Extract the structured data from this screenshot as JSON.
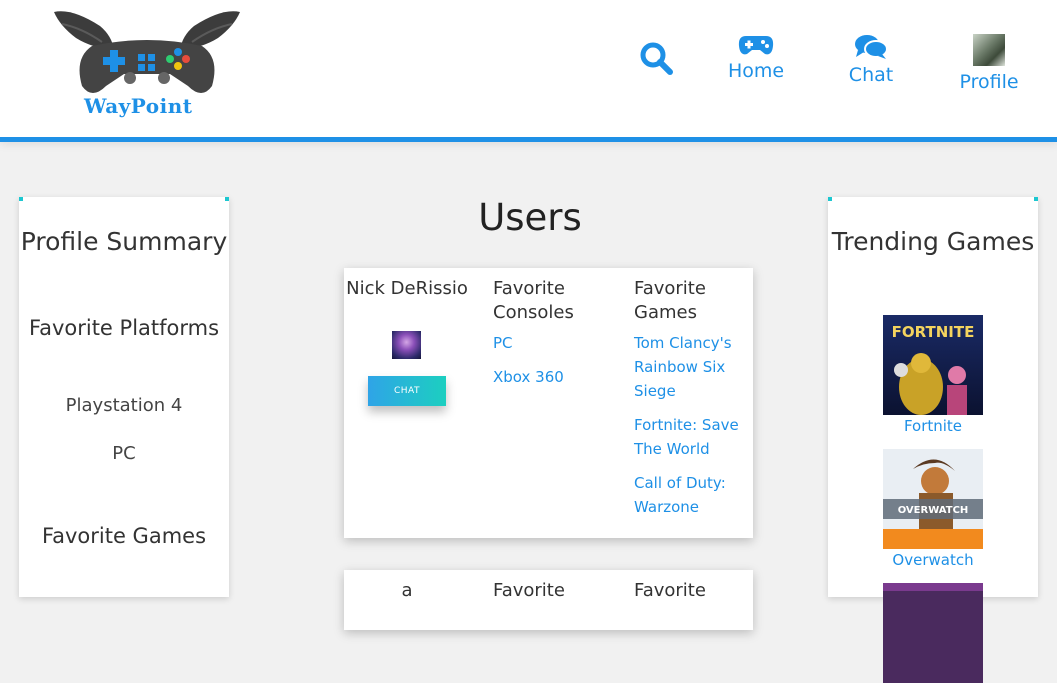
{
  "brand": {
    "name": "WayPoint"
  },
  "nav": {
    "home_label": "Home",
    "chat_label": "Chat",
    "profile_label": "Profile"
  },
  "colors": {
    "accent": "#1e90e6",
    "button_gradient_start": "#2fa4e7",
    "button_gradient_end": "#1ccfc0"
  },
  "profile_summary": {
    "title": "Profile Summary",
    "favorite_platforms_title": "Favorite Platforms",
    "platforms": [
      "Playstation 4",
      "PC"
    ],
    "favorite_games_title": "Favorite Games"
  },
  "users_title": "Users",
  "users": [
    {
      "name": "Nick DeRissio",
      "consoles_header": "Favorite Consoles",
      "games_header": "Favorite Games",
      "consoles": [
        "PC",
        "Xbox 360"
      ],
      "games": [
        "Tom Clancy's Rainbow Six Siege",
        "Fortnite: Save The World",
        "Call of Duty: Warzone"
      ],
      "chat_label": "CHAT"
    },
    {
      "name": "a",
      "consoles_header": "Favorite",
      "games_header": "Favorite"
    }
  ],
  "trending": {
    "title": "Trending Games",
    "games": [
      {
        "label": "Fortnite",
        "cover_text": "FORTNITE"
      },
      {
        "label": "Overwatch",
        "cover_text": "OVERWATCH"
      }
    ]
  }
}
